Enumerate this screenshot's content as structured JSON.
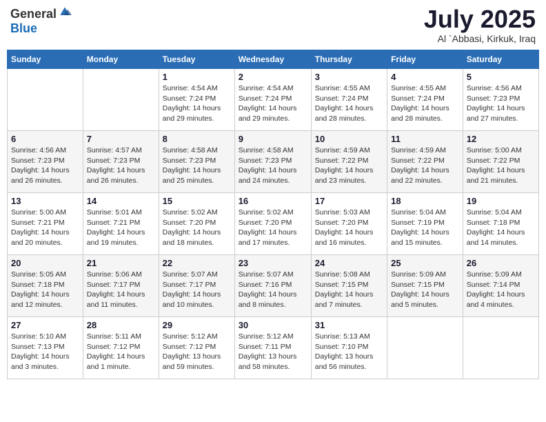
{
  "header": {
    "logo": {
      "general": "General",
      "blue": "Blue"
    },
    "title": "July 2025",
    "location": "Al `Abbasi, Kirkuk, Iraq"
  },
  "weekdays": [
    "Sunday",
    "Monday",
    "Tuesday",
    "Wednesday",
    "Thursday",
    "Friday",
    "Saturday"
  ],
  "weeks": [
    [
      {
        "day": "",
        "info": ""
      },
      {
        "day": "",
        "info": ""
      },
      {
        "day": "1",
        "info": "Sunrise: 4:54 AM\nSunset: 7:24 PM\nDaylight: 14 hours and 29 minutes."
      },
      {
        "day": "2",
        "info": "Sunrise: 4:54 AM\nSunset: 7:24 PM\nDaylight: 14 hours and 29 minutes."
      },
      {
        "day": "3",
        "info": "Sunrise: 4:55 AM\nSunset: 7:24 PM\nDaylight: 14 hours and 28 minutes."
      },
      {
        "day": "4",
        "info": "Sunrise: 4:55 AM\nSunset: 7:24 PM\nDaylight: 14 hours and 28 minutes."
      },
      {
        "day": "5",
        "info": "Sunrise: 4:56 AM\nSunset: 7:23 PM\nDaylight: 14 hours and 27 minutes."
      }
    ],
    [
      {
        "day": "6",
        "info": "Sunrise: 4:56 AM\nSunset: 7:23 PM\nDaylight: 14 hours and 26 minutes."
      },
      {
        "day": "7",
        "info": "Sunrise: 4:57 AM\nSunset: 7:23 PM\nDaylight: 14 hours and 26 minutes."
      },
      {
        "day": "8",
        "info": "Sunrise: 4:58 AM\nSunset: 7:23 PM\nDaylight: 14 hours and 25 minutes."
      },
      {
        "day": "9",
        "info": "Sunrise: 4:58 AM\nSunset: 7:23 PM\nDaylight: 14 hours and 24 minutes."
      },
      {
        "day": "10",
        "info": "Sunrise: 4:59 AM\nSunset: 7:22 PM\nDaylight: 14 hours and 23 minutes."
      },
      {
        "day": "11",
        "info": "Sunrise: 4:59 AM\nSunset: 7:22 PM\nDaylight: 14 hours and 22 minutes."
      },
      {
        "day": "12",
        "info": "Sunrise: 5:00 AM\nSunset: 7:22 PM\nDaylight: 14 hours and 21 minutes."
      }
    ],
    [
      {
        "day": "13",
        "info": "Sunrise: 5:00 AM\nSunset: 7:21 PM\nDaylight: 14 hours and 20 minutes."
      },
      {
        "day": "14",
        "info": "Sunrise: 5:01 AM\nSunset: 7:21 PM\nDaylight: 14 hours and 19 minutes."
      },
      {
        "day": "15",
        "info": "Sunrise: 5:02 AM\nSunset: 7:20 PM\nDaylight: 14 hours and 18 minutes."
      },
      {
        "day": "16",
        "info": "Sunrise: 5:02 AM\nSunset: 7:20 PM\nDaylight: 14 hours and 17 minutes."
      },
      {
        "day": "17",
        "info": "Sunrise: 5:03 AM\nSunset: 7:20 PM\nDaylight: 14 hours and 16 minutes."
      },
      {
        "day": "18",
        "info": "Sunrise: 5:04 AM\nSunset: 7:19 PM\nDaylight: 14 hours and 15 minutes."
      },
      {
        "day": "19",
        "info": "Sunrise: 5:04 AM\nSunset: 7:18 PM\nDaylight: 14 hours and 14 minutes."
      }
    ],
    [
      {
        "day": "20",
        "info": "Sunrise: 5:05 AM\nSunset: 7:18 PM\nDaylight: 14 hours and 12 minutes."
      },
      {
        "day": "21",
        "info": "Sunrise: 5:06 AM\nSunset: 7:17 PM\nDaylight: 14 hours and 11 minutes."
      },
      {
        "day": "22",
        "info": "Sunrise: 5:07 AM\nSunset: 7:17 PM\nDaylight: 14 hours and 10 minutes."
      },
      {
        "day": "23",
        "info": "Sunrise: 5:07 AM\nSunset: 7:16 PM\nDaylight: 14 hours and 8 minutes."
      },
      {
        "day": "24",
        "info": "Sunrise: 5:08 AM\nSunset: 7:15 PM\nDaylight: 14 hours and 7 minutes."
      },
      {
        "day": "25",
        "info": "Sunrise: 5:09 AM\nSunset: 7:15 PM\nDaylight: 14 hours and 5 minutes."
      },
      {
        "day": "26",
        "info": "Sunrise: 5:09 AM\nSunset: 7:14 PM\nDaylight: 14 hours and 4 minutes."
      }
    ],
    [
      {
        "day": "27",
        "info": "Sunrise: 5:10 AM\nSunset: 7:13 PM\nDaylight: 14 hours and 3 minutes."
      },
      {
        "day": "28",
        "info": "Sunrise: 5:11 AM\nSunset: 7:12 PM\nDaylight: 14 hours and 1 minute."
      },
      {
        "day": "29",
        "info": "Sunrise: 5:12 AM\nSunset: 7:12 PM\nDaylight: 13 hours and 59 minutes."
      },
      {
        "day": "30",
        "info": "Sunrise: 5:12 AM\nSunset: 7:11 PM\nDaylight: 13 hours and 58 minutes."
      },
      {
        "day": "31",
        "info": "Sunrise: 5:13 AM\nSunset: 7:10 PM\nDaylight: 13 hours and 56 minutes."
      },
      {
        "day": "",
        "info": ""
      },
      {
        "day": "",
        "info": ""
      }
    ]
  ]
}
